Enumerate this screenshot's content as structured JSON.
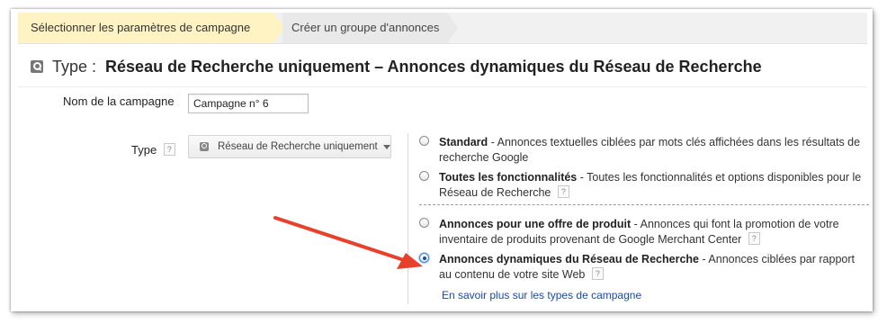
{
  "steps": [
    {
      "label": "Sélectionner les paramètres de campagne"
    },
    {
      "label": "Créer un groupe d'annonces"
    }
  ],
  "header": {
    "prefix": "Type :",
    "title": "Réseau de Recherche uniquement – Annonces dynamiques du Réseau de Recherche"
  },
  "form": {
    "name_label": "Nom de la campagne",
    "name_value": "Campagne n° 6",
    "type_label": "Type",
    "type_selected": "Réseau de Recherche uniquement",
    "help_glyph": "?"
  },
  "options": [
    {
      "title": "Standard",
      "desc": " - Annonces textuelles ciblées par mots clés affichées dans les résultats de recherche Google",
      "checked": false
    },
    {
      "title": "Toutes les fonctionnalités",
      "desc": " - Toutes les fonctionnalités et options disponibles pour le Réseau de Recherche",
      "checked": false
    },
    {
      "title": "Annonces pour une offre de produit",
      "desc": " - Annonces qui font la promotion de votre inventaire de produits provenant de Google Merchant Center",
      "checked": false
    },
    {
      "title": "Annonces dynamiques du Réseau de Recherche",
      "desc": " - Annonces ciblées par rapport au contenu de votre site Web",
      "checked": true
    }
  ],
  "learn_more": "En savoir plus sur les types de campagne",
  "colors": {
    "accent_arrow": "#e8402a",
    "active_step": "#fff3c4",
    "link": "#1a4aa6"
  },
  "icons": {
    "type_icon": "search-icon",
    "dropdown_icon": "search-icon",
    "dropdown_caret": "chevron-down-icon",
    "annotation": "red-arrow"
  }
}
